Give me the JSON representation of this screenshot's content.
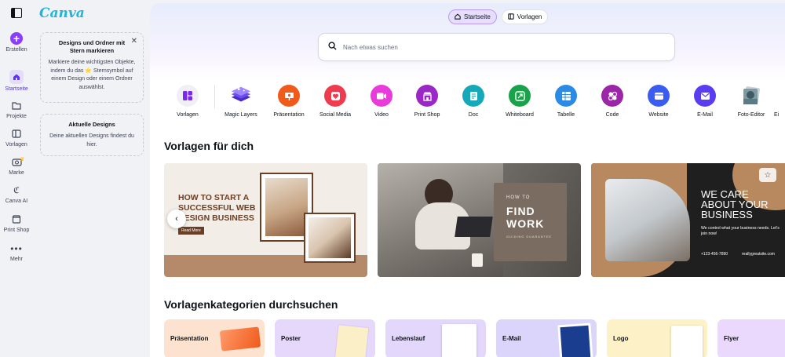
{
  "rail": {
    "items": [
      {
        "label": "Erstellen"
      },
      {
        "label": "Startseite"
      },
      {
        "label": "Projekte"
      },
      {
        "label": "Vorlagen"
      },
      {
        "label": "Marke"
      },
      {
        "label": "Canva AI"
      },
      {
        "label": "Print Shop"
      },
      {
        "label": "Mehr"
      }
    ]
  },
  "brand": {
    "logo_text": "Canva"
  },
  "panel": {
    "starred": {
      "title": "Designs und Ordner mit Stern markieren",
      "body": "Markiere deine wichtigsten Objekte, indem du das ⭐ Sternsymbol auf einem Design oder einem Ordner auswählst.",
      "close": "✕"
    },
    "recent": {
      "title": "Aktuelle Designs",
      "body": "Deine aktuellen Designs findest du hier."
    }
  },
  "tabs": [
    {
      "label": "Startseite",
      "active": true
    },
    {
      "label": "Vorlagen",
      "active": false
    }
  ],
  "search": {
    "placeholder": "Nach etwas suchen"
  },
  "shortcuts": [
    {
      "label": "Vorlagen",
      "color": "#eef0f6",
      "icon": "templates-icon"
    },
    {
      "label": "Magic Layers",
      "color": "#6d4cf0",
      "icon": "layers-icon"
    },
    {
      "label": "Präsentation",
      "color": "#f05a1a",
      "icon": "presentation-icon"
    },
    {
      "label": "Social Media",
      "color": "#ef3b4e",
      "icon": "heart-icon"
    },
    {
      "label": "Video",
      "color": "#e83bd9",
      "icon": "video-icon"
    },
    {
      "label": "Print Shop",
      "color": "#9b27c7",
      "icon": "shop-icon"
    },
    {
      "label": "Doc",
      "color": "#14a8b8",
      "icon": "doc-icon"
    },
    {
      "label": "Whiteboard",
      "color": "#16a34a",
      "icon": "whiteboard-icon"
    },
    {
      "label": "Tabelle",
      "color": "#2b8ae6",
      "icon": "table-icon"
    },
    {
      "label": "Code",
      "color": "#9b27a8",
      "icon": "code-icon"
    },
    {
      "label": "Website",
      "color": "#3b5cf0",
      "icon": "website-icon"
    },
    {
      "label": "E-Mail",
      "color": "#5a3df0",
      "icon": "mail-icon"
    },
    {
      "label": "Foto-Editor",
      "color": "#8aa0a8",
      "icon": "photo-icon"
    },
    {
      "label": "Ei",
      "color": "#cccccc",
      "icon": "more-icon"
    }
  ],
  "sections": {
    "templates": "Vorlagen für dich",
    "categories": "Vorlagenkategorien durchsuchen"
  },
  "templates": [
    {
      "line1": "HOW TO START A",
      "line2": "SUCCESSFUL WEB",
      "line3": "DESIGN BUSINESS",
      "button": "Read More"
    },
    {
      "pre": "HOW TO",
      "big1": "FIND",
      "big2": "WORK",
      "sub": "GUIDING GUARANTEE"
    },
    {
      "line1": "WE CARE",
      "line2": "ABOUT YOUR",
      "line3": "BUSINESS",
      "body": "We control what your business needs. Let's join now!",
      "phone": "+123-456-7890",
      "site": "reallygreatsite.com"
    }
  ],
  "categories": [
    {
      "label": "Präsentation",
      "color": "#fde2cf"
    },
    {
      "label": "Poster",
      "color": "#e5d8fb"
    },
    {
      "label": "Lebenslauf",
      "color": "#e3d8fb"
    },
    {
      "label": "E-Mail",
      "color": "#dcd5fb"
    },
    {
      "label": "Logo",
      "color": "#fdf1c7"
    },
    {
      "label": "Flyer",
      "color": "#ead9fc"
    }
  ]
}
